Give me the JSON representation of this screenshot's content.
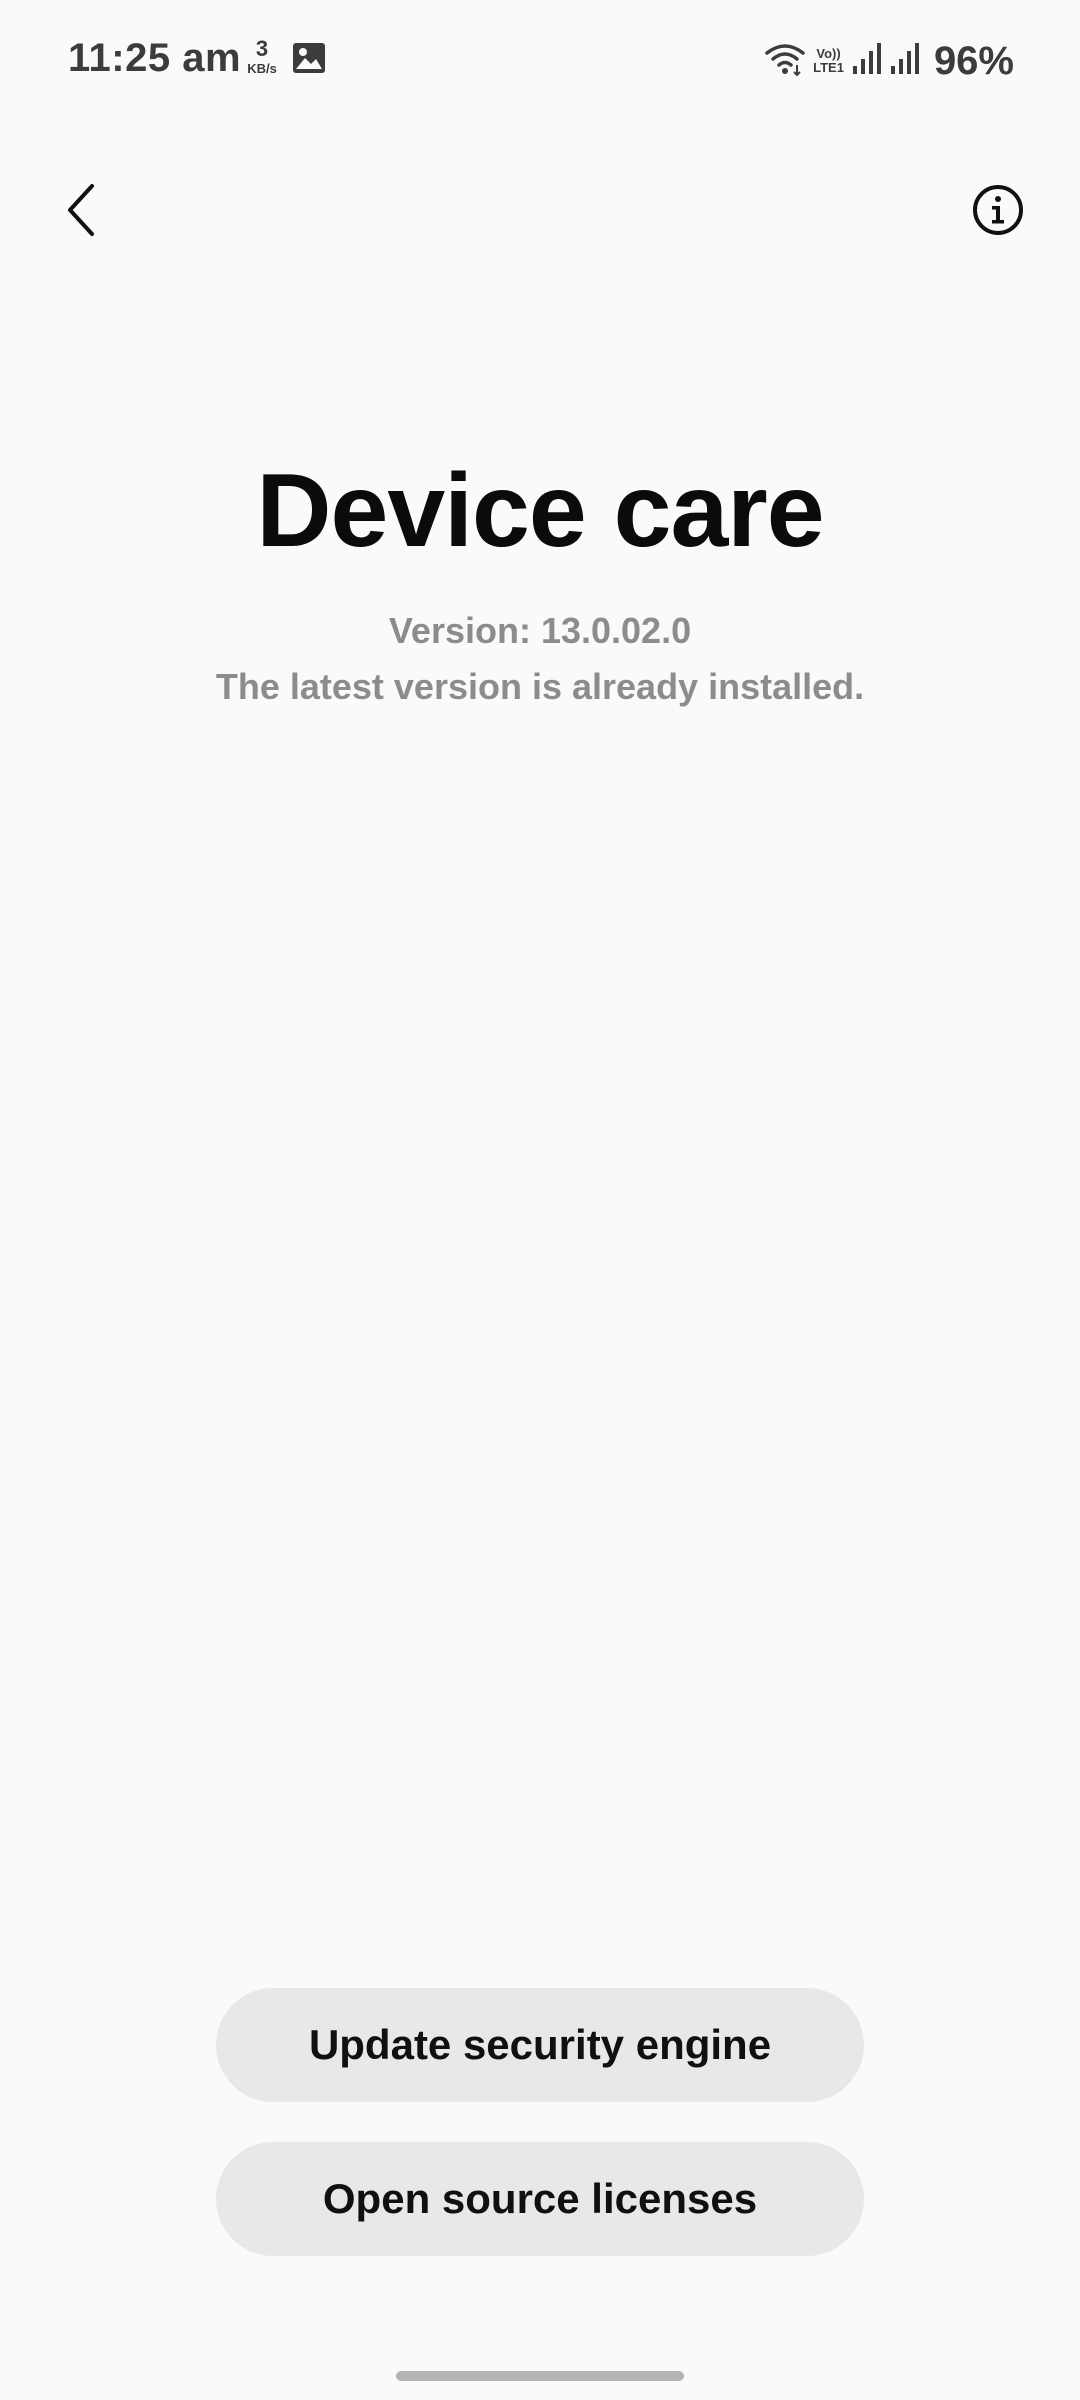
{
  "status_bar": {
    "time": "11:25 am",
    "net_speed_value": "3",
    "net_speed_unit": "KB/s",
    "volte_label_top": "Vo))",
    "volte_label_bottom": "LTE1",
    "battery": "96%",
    "icons": [
      "gallery-icon",
      "wifi-icon",
      "volte-icon",
      "signal-icon",
      "signal-icon"
    ]
  },
  "app_bar": {
    "back_icon": "chevron-left-icon",
    "info_icon": "info-icon"
  },
  "main": {
    "title": "Device care",
    "version": "Version: 13.0.02.0",
    "status": "The latest version is already installed."
  },
  "actions": {
    "update_label": "Update security engine",
    "licenses_label": "Open source licenses"
  },
  "colors": {
    "background": "#fafafa",
    "button_bg": "#e8e8e8",
    "subtle_text": "#8c8c8c"
  }
}
